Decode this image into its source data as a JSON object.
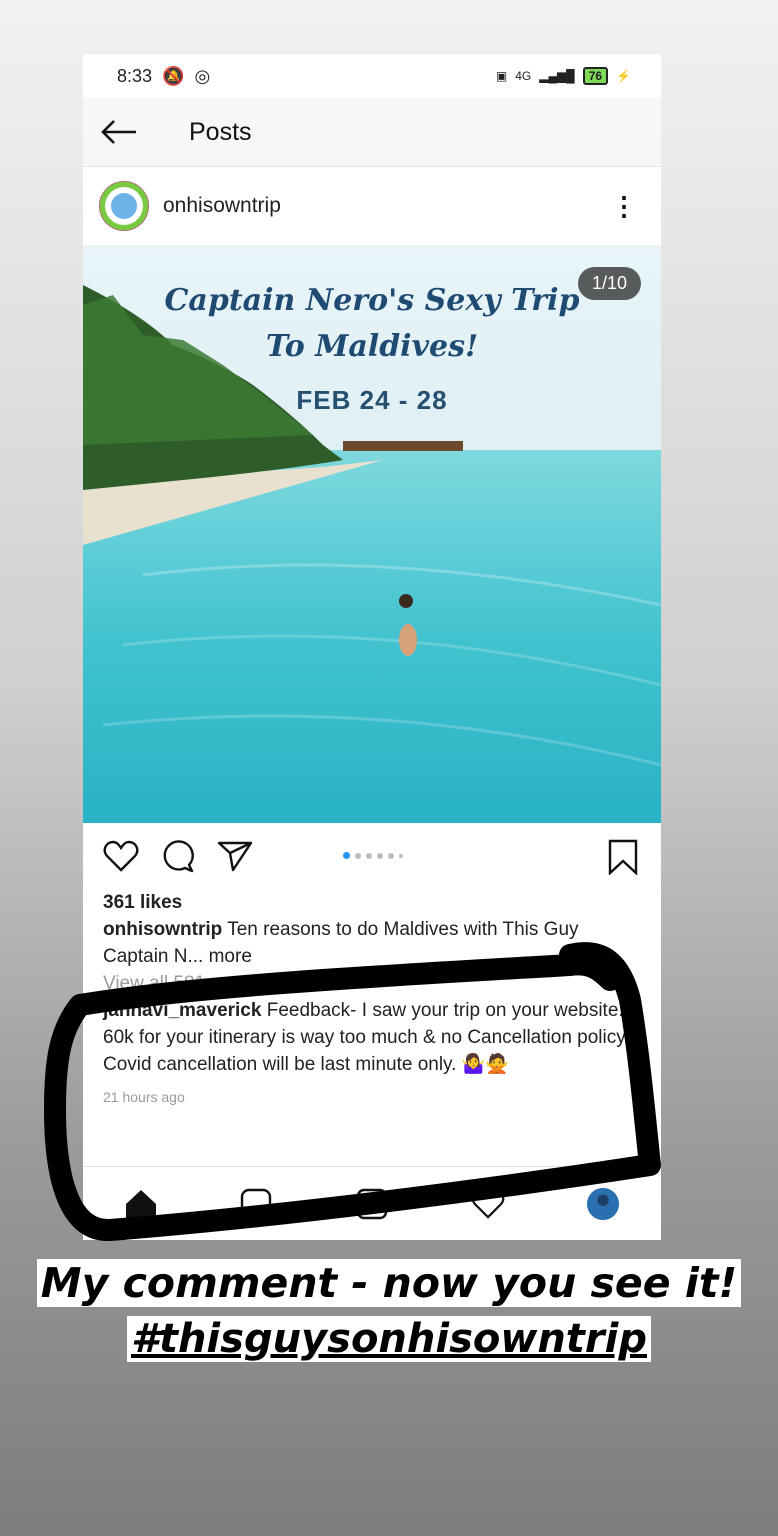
{
  "status_bar": {
    "time": "8:33",
    "network": "4G",
    "battery": "76"
  },
  "app_bar": {
    "title": "Posts"
  },
  "post": {
    "username": "onhisowntrip",
    "image_counter": "1/10",
    "image_text": {
      "line1": "Captain Nero's Sexy Trip",
      "line2": "To Maldives!",
      "dates": "FEB 24 - 28"
    },
    "carousel": {
      "current": 1,
      "total": 10
    },
    "likes": "361 likes",
    "caption_user": "onhisowntrip",
    "caption_text": "Ten reasons to do Maldives with This Guy",
    "caption_more": "Captain N... more",
    "view_comments": "View all 581 comments",
    "comment_user": "jahnavi_maverick",
    "comment_text": "Feedback- I saw your trip on your website. 60k for your itinerary is way too much & no Cancellation policy. Covid cancellation will be last minute only. 🤷‍♀️🙅",
    "comment_time": "21 hours ago"
  },
  "overlay_caption": {
    "line1": "My comment - now you see it!",
    "line2": "#thisguysonhisowntrip"
  },
  "colors": {
    "accent_blue": "#2196f3",
    "ocean": "#3fc6d2",
    "scribble": "#000000"
  }
}
